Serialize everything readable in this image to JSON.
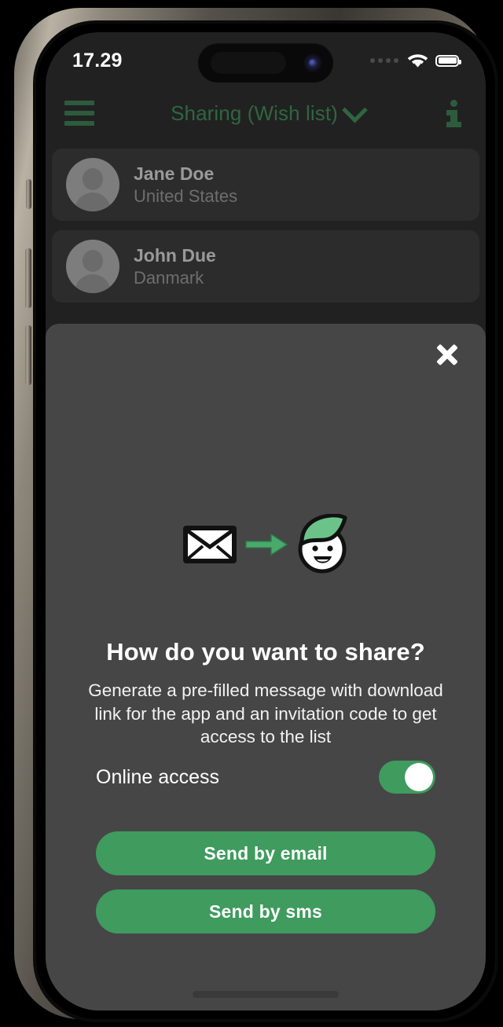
{
  "status_bar": {
    "time": "17.29",
    "signal_icon": "cellular-dots-icon",
    "wifi_icon": "wifi-icon",
    "battery_icon": "battery-full-icon"
  },
  "header": {
    "menu_icon": "hamburger-menu-icon",
    "title": "Sharing (Wish list)",
    "chevron_icon": "chevron-down-icon",
    "info_icon": "info-icon",
    "accent_color": "#2f6640"
  },
  "contacts": [
    {
      "name": "Jane Doe",
      "country": "United States",
      "avatar_icon": "person-placeholder-avatar"
    },
    {
      "name": "John Due",
      "country": "Danmark",
      "avatar_icon": "person-placeholder-avatar"
    }
  ],
  "sheet": {
    "close_icon": "close-icon",
    "illustration": {
      "envelope_icon": "envelope-icon",
      "arrow_icon": "arrow-right-icon",
      "person_icon": "person-face-green-hair-icon"
    },
    "title": "How do you want to share?",
    "description": "Generate a pre-filled message with download link for the app and an invitation code to get access to the list",
    "toggle": {
      "label": "Online access",
      "value": "on"
    },
    "buttons": [
      {
        "label": "Send by email"
      },
      {
        "label": "Send by sms"
      }
    ],
    "background_color": "#464646",
    "accent_color": "#3f9b5e"
  },
  "home_indicator": "home-indicator"
}
